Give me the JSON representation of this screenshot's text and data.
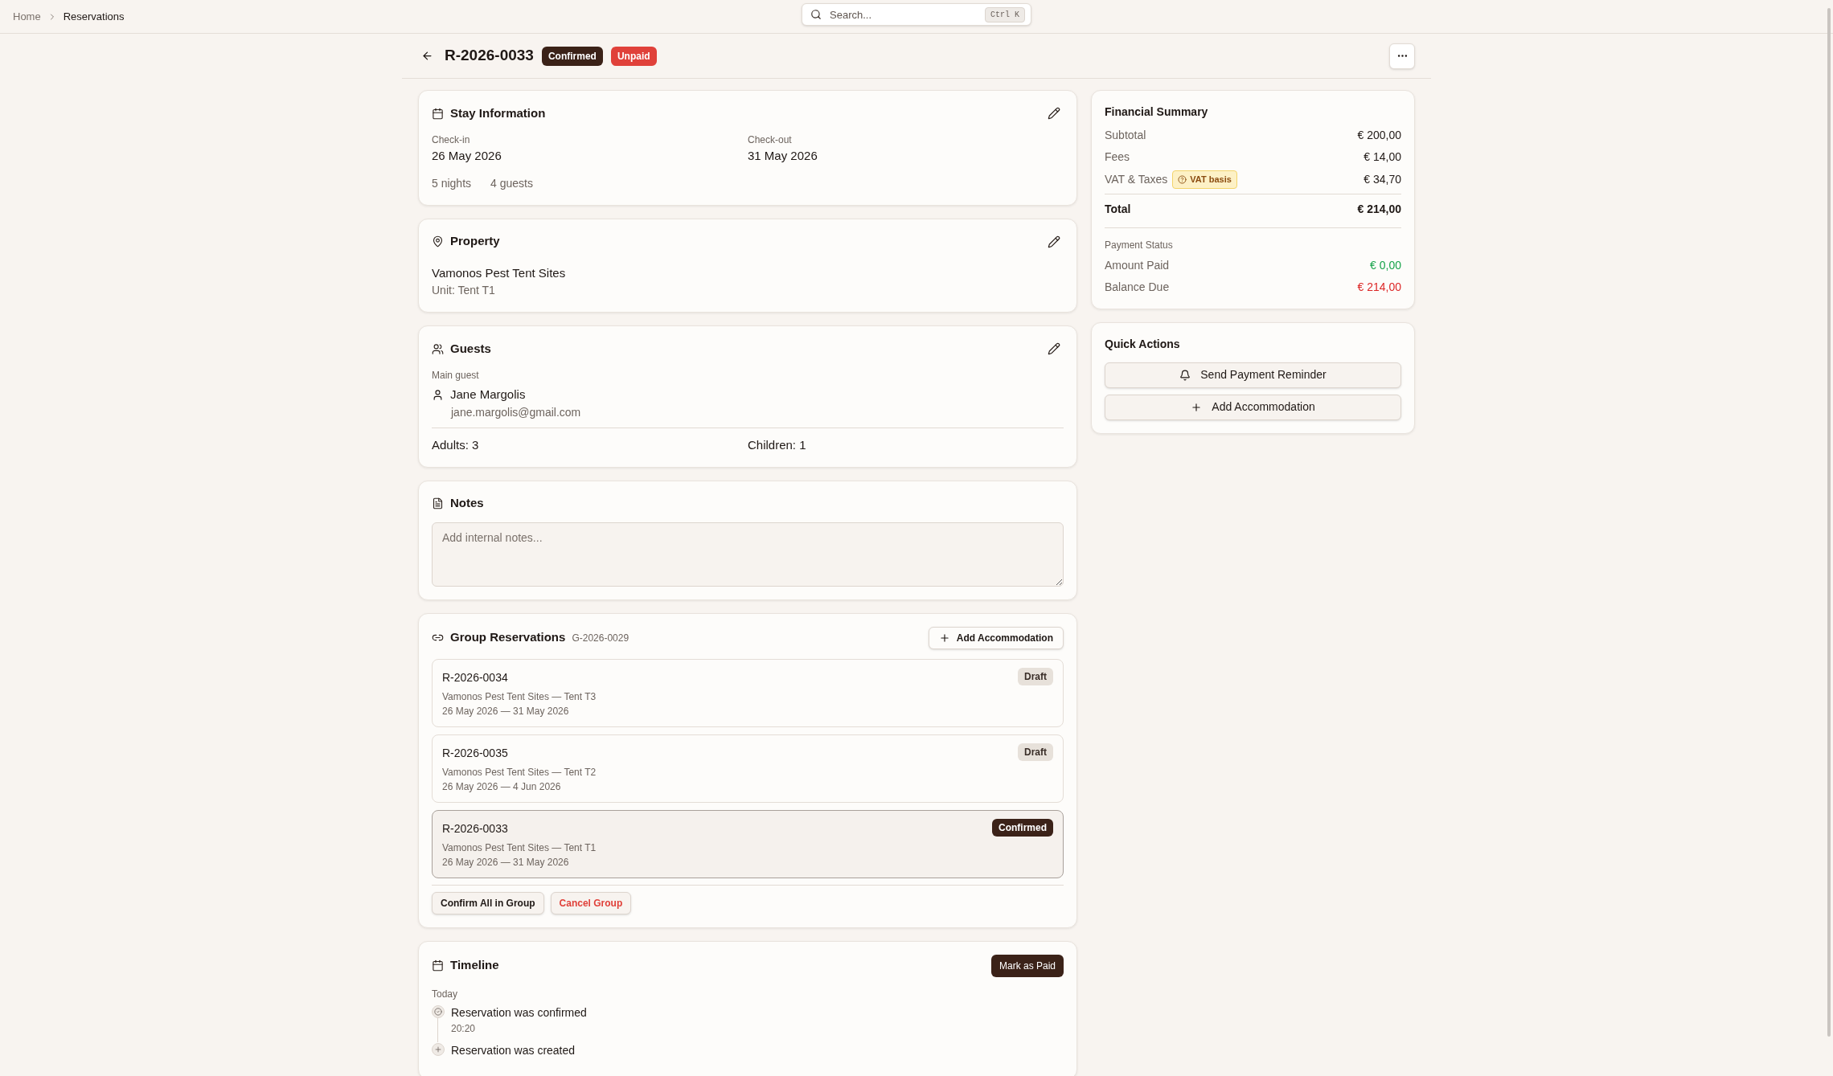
{
  "breadcrumb": [
    {
      "label": "Home",
      "current": false
    },
    {
      "label": "Reservations",
      "current": true
    }
  ],
  "search": {
    "placeholder": "Search...",
    "shortcut": "Ctrl K"
  },
  "header": {
    "title": "R-2026-0033",
    "badges": [
      {
        "label": "Confirmed",
        "kind": "confirmed"
      },
      {
        "label": "Unpaid",
        "kind": "unpaid"
      }
    ]
  },
  "stay": {
    "title": "Stay Information",
    "checkin_label": "Check-in",
    "checkin": "26 May 2026",
    "checkout_label": "Check-out",
    "checkout": "31 May 2026",
    "nights": "5 nights",
    "guests": "4 guests"
  },
  "property": {
    "title": "Property",
    "name": "Vamonos Pest Tent Sites",
    "unit": "Unit: Tent T1"
  },
  "guests": {
    "title": "Guests",
    "main_label": "Main guest",
    "name": "Jane Margolis",
    "email": "jane.margolis@gmail.com",
    "adults": "Adults: 3",
    "children": "Children: 1"
  },
  "notes": {
    "title": "Notes",
    "placeholder": "Add internal notes..."
  },
  "group": {
    "title": "Group Reservations",
    "code": "G-2026-0029",
    "add_button": "Add Accommodation",
    "items": [
      {
        "id": "R-2026-0034",
        "property": "Vamonos Pest Tent Sites — Tent T3",
        "dates": "26 May 2026 — 31 May 2026",
        "status": "Draft",
        "kind": "draft",
        "selected": false
      },
      {
        "id": "R-2026-0035",
        "property": "Vamonos Pest Tent Sites — Tent T2",
        "dates": "26 May 2026 — 4 Jun 2026",
        "status": "Draft",
        "kind": "draft",
        "selected": false
      },
      {
        "id": "R-2026-0033",
        "property": "Vamonos Pest Tent Sites — Tent T1",
        "dates": "26 May 2026 — 31 May 2026",
        "status": "Confirmed",
        "kind": "confirmed",
        "selected": true
      }
    ],
    "buttons": [
      {
        "label": "Confirm All in Group",
        "kind": "normal"
      },
      {
        "label": "Cancel Group",
        "kind": "danger"
      }
    ]
  },
  "timeline": {
    "title": "Timeline",
    "action": "Mark as Paid",
    "day": "Today",
    "events": [
      {
        "kind": "confirmed",
        "text": "Reservation was confirmed",
        "time": "20:20"
      },
      {
        "kind": "created",
        "text": "Reservation was created"
      }
    ]
  },
  "financial": {
    "title": "Financial Summary",
    "rows": [
      {
        "label": "Subtotal",
        "value": "€ 200,00"
      },
      {
        "label": "Fees",
        "value": "€ 14,00"
      },
      {
        "label": "VAT & Taxes",
        "value": "€ 34,70",
        "badge": "VAT basis"
      }
    ],
    "total": {
      "label": "Total",
      "value": "€ 214,00"
    },
    "payment_label": "Payment Status",
    "payments": [
      {
        "label": "Amount Paid",
        "value": "€ 0,00",
        "kind": "paid"
      },
      {
        "label": "Balance Due",
        "value": "€ 214,00",
        "kind": "due"
      }
    ]
  },
  "quick_actions": {
    "title": "Quick Actions",
    "buttons": [
      {
        "label": "Send Payment Reminder",
        "kind": "reminder"
      },
      {
        "label": "Add Accommodation",
        "kind": "add"
      }
    ]
  }
}
